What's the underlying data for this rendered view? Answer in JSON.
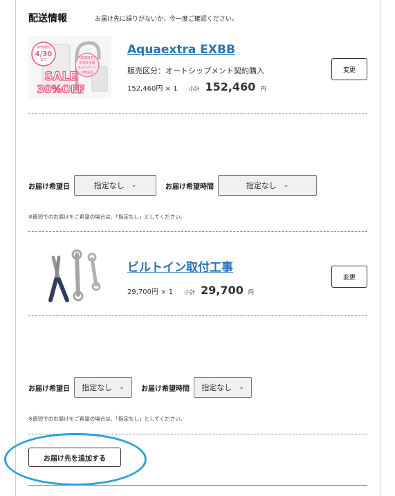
{
  "section": {
    "title": "配送情報",
    "note": "お届け先に誤りがないか、今一度ご確認ください。"
  },
  "items": [
    {
      "name": "Aquaextra EXBB",
      "type_line": "販売区分：オートシップメント契約購入",
      "unit_price": "152,460円 × 1",
      "subtotal_label": "小計",
      "subtotal_value": "152,460",
      "yen": "円",
      "change_label": "変更",
      "badge_top": "特価期間",
      "badge_date": "4/30",
      "badge_bottom": "まで",
      "promo_small_1": "【期間限定】",
      "promo_small_2": "新規浄水器",
      "promo_small_3": "キャンペーン",
      "promo_small_4": "対象商品",
      "sale_text": "SALE",
      "sale_pct": "30%OFF"
    },
    {
      "name": "ビルトイン取付工事",
      "unit_price": "29,700円 × 1",
      "subtotal_label": "小計",
      "subtotal_value": "29,700",
      "yen": "円",
      "change_label": "変更"
    }
  ],
  "delivery": [
    {
      "date_label": "お届け希望日",
      "date_value": "指定なし",
      "time_label": "お届け希望時間",
      "time_value": "指定なし",
      "note": "※最短でのお届けをご希望の場合は、「指定なし」としてください。"
    },
    {
      "date_label": "お届け希望日",
      "date_value": "指定なし",
      "time_label": "お届け希望時間",
      "time_value": "指定なし",
      "note": "※最短でのお届けをご希望の場合は、「指定なし」としてください。"
    }
  ],
  "add_address_label": "お届け先を追加する",
  "colors": {
    "link": "#2a73b8",
    "highlight": "#29a0e0",
    "sale_pink": "#e8557a"
  }
}
